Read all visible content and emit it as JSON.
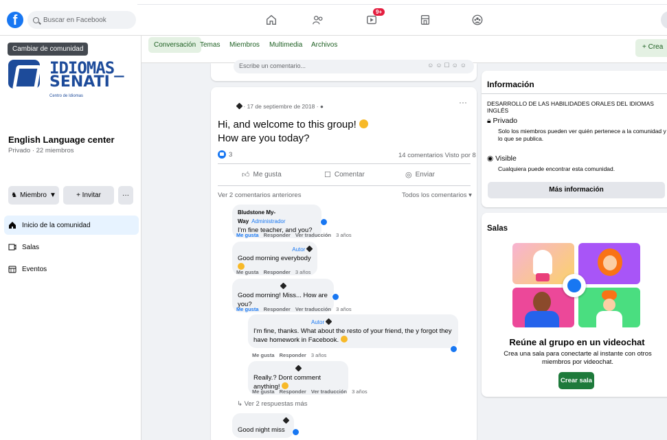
{
  "topbar": {
    "search_placeholder": "Buscar en Facebook",
    "badge": "9+"
  },
  "sidebar": {
    "tooltip": "Cambiar de comunidad",
    "logo_line1": "IDIOMAS_",
    "logo_line2": "SENATI",
    "logo_sub": "Centro de Idiomas",
    "group_name": "English Language center",
    "group_meta": "Privado · 22 miembros",
    "member_button": "Miembro",
    "invite_button": "+ Invitar",
    "more_button": "···",
    "items": [
      {
        "label": "Inicio de la comunidad",
        "icon": "home-icon"
      },
      {
        "label": "Salas",
        "icon": "rooms-icon"
      },
      {
        "label": "Eventos",
        "icon": "calendar-icon"
      }
    ]
  },
  "tabs": {
    "conversacion": "Conversación",
    "temas": "Temas",
    "miembros": "Miembros",
    "multimedia": "Multimedia",
    "archivos": "Archivos",
    "crea": "+ Crea"
  },
  "post": {
    "comment_placeholder": "Escribe un comentario...",
    "date": "· 17 de septiembre de 2018 ·",
    "line1": "Hi, and welcome to this group!",
    "line2": "How are you today?",
    "reaction_count": "3",
    "stats": "14 comentarios  Visto por 8",
    "like": "Me gusta",
    "comment": "Comentar",
    "send": "Enviar",
    "prev_comments": "Ver 2 comentarios anteriores",
    "all_comments": "Todos los comentarios ▾",
    "more_replies": "Ver 2 respuestas más"
  },
  "comments": [
    {
      "author": "Bludstone My-Way",
      "role": "Administrador",
      "text": "I'm fine teacher, and you?",
      "meta_like": "Me gusta",
      "meta_reply": "Responder",
      "meta_translate": "Ver traducción",
      "meta_time": "3 años"
    },
    {
      "role": "Autor",
      "text": "Good morning everybody",
      "meta_like": "Me gusta",
      "meta_reply": "Responder",
      "meta_time": "3 años"
    },
    {
      "text": "Good morning! Miss... How are you?",
      "meta_like": "Me gusta",
      "meta_reply": "Responder",
      "meta_translate": "Ver traducción",
      "meta_time": "3 años"
    },
    {
      "role": "Autor",
      "text": "I'm fine, thanks. What about the resto of your friend, the y forgot they have homework in Facebook.",
      "meta_like": "Me gusta",
      "meta_reply": "Responder",
      "meta_time": "3 años"
    },
    {
      "text": "Really.? Dont comment anything!",
      "meta_like": "Me gusta",
      "meta_reply": "Responder",
      "meta_translate": "Ver traducción",
      "meta_time": "3 años"
    },
    {
      "text": "Good night miss"
    }
  ],
  "info": {
    "title": "Información",
    "description": "DESARROLLO DE LAS HABILIDADES ORALES DEL IDIOMAS INGLÉS",
    "private_title": "Privado",
    "private_desc": "Solo los miembros pueden ver quién pertenece a la comunidad y lo que se publica.",
    "visible_title": "Visible",
    "visible_desc": "Cualquiera puede encontrar esta comunidad.",
    "more_button": "Más información"
  },
  "salas": {
    "title": "Salas",
    "vc_title": "Reúne al grupo en un videochat",
    "vc_desc": "Crea una sala para conectarte al instante con otros miembros por videochat.",
    "create_button": "Crear sala"
  },
  "colors": {
    "facebook_blue": "#1877f2",
    "group_green": "#1e7a3b",
    "badge_red": "#e41e3f"
  }
}
